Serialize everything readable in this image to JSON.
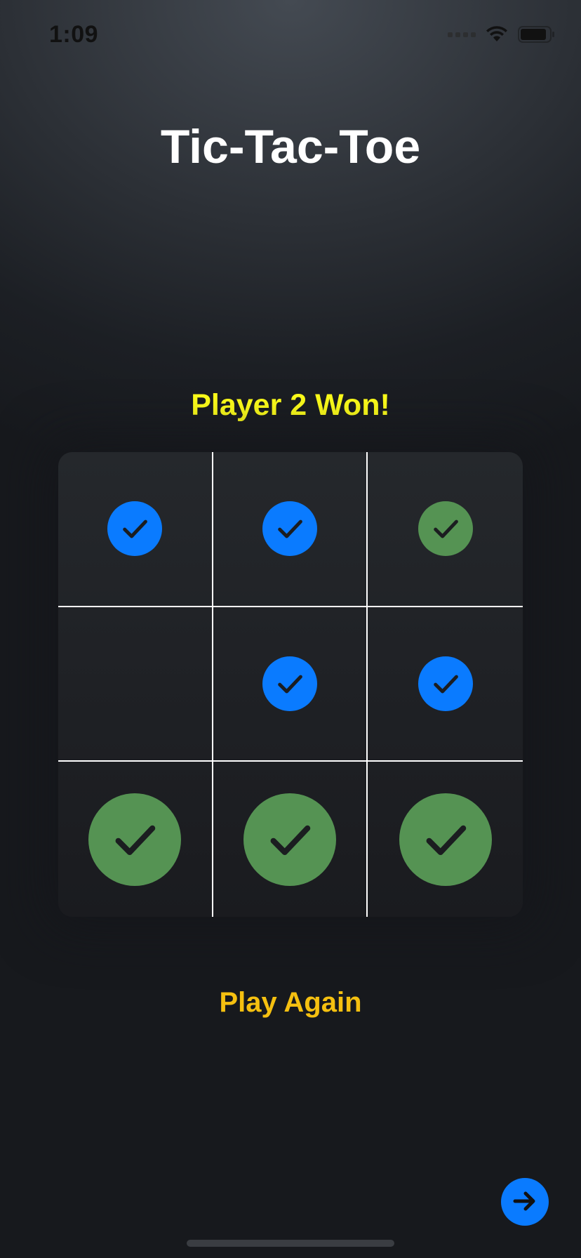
{
  "status_bar": {
    "time": "1:09",
    "icons": [
      "cellular-signal-icon",
      "wifi-icon",
      "battery-icon"
    ]
  },
  "app": {
    "title": "Tic-Tac-Toe"
  },
  "game": {
    "result": "Player 2 Won!",
    "result_color": "#ffff1a",
    "board": [
      [
        "player1",
        "player1",
        "player2"
      ],
      [
        "empty",
        "player1",
        "player1"
      ],
      [
        "player2",
        "player2",
        "player2"
      ]
    ],
    "winning_row": 3,
    "mark_icon": "checkmark-circle-icon",
    "player1_color": "#0a7bff",
    "player2_color": "#559353"
  },
  "actions": {
    "play_again_label": "Play Again",
    "play_again_color": "#f5c010",
    "next_icon": "arrow-right-icon",
    "next_color": "#0a7bff"
  }
}
